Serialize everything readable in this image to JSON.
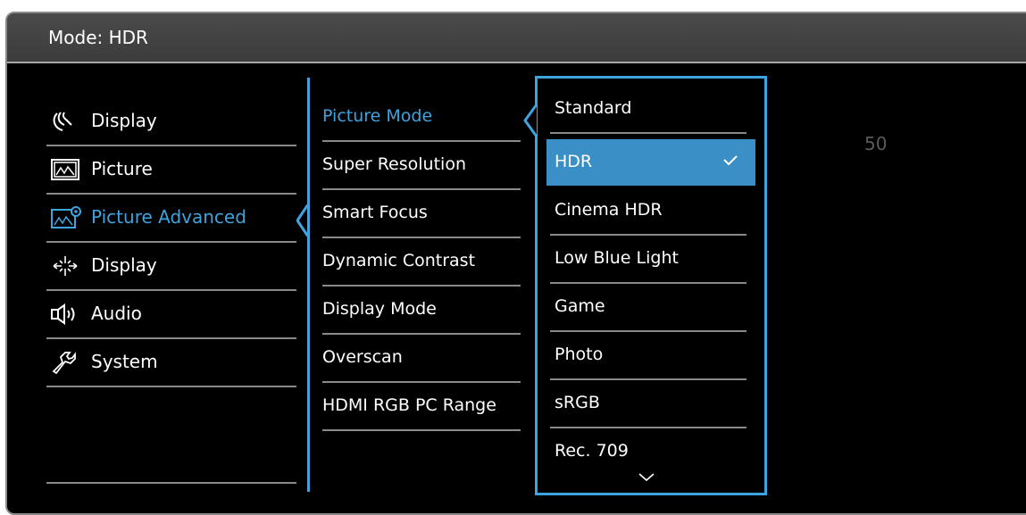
{
  "header": {
    "title": "Mode: HDR"
  },
  "menu_level1": [
    {
      "label": "Display",
      "icon": "display-input-icon",
      "active": false
    },
    {
      "label": "Picture",
      "icon": "picture-icon",
      "active": false
    },
    {
      "label": "Picture Advanced",
      "icon": "picture-advanced-icon",
      "active": true
    },
    {
      "label": "Display",
      "icon": "display-sparkle-icon",
      "active": false
    },
    {
      "label": "Audio",
      "icon": "speaker-icon",
      "active": false
    },
    {
      "label": "System",
      "icon": "wrench-icon",
      "active": false
    }
  ],
  "menu_level2": [
    {
      "label": "Picture Mode",
      "active": true
    },
    {
      "label": "Super Resolution"
    },
    {
      "label": "Smart Focus"
    },
    {
      "label": "Dynamic Contrast"
    },
    {
      "label": "Display Mode"
    },
    {
      "label": "Overscan"
    },
    {
      "label": "HDMI RGB PC Range"
    }
  ],
  "menu_level3": [
    {
      "label": "Standard"
    },
    {
      "label": "HDR",
      "selected": true
    },
    {
      "label": "Cinema HDR"
    },
    {
      "label": "Low Blue Light"
    },
    {
      "label": "Game"
    },
    {
      "label": "Photo"
    },
    {
      "label": "sRGB"
    },
    {
      "label": "Rec. 709"
    }
  ],
  "side_value": "50",
  "colors": {
    "accent": "#3ea4e0",
    "selection": "#3a8fc6",
    "background": "#000000",
    "title_bar": "#444444"
  }
}
